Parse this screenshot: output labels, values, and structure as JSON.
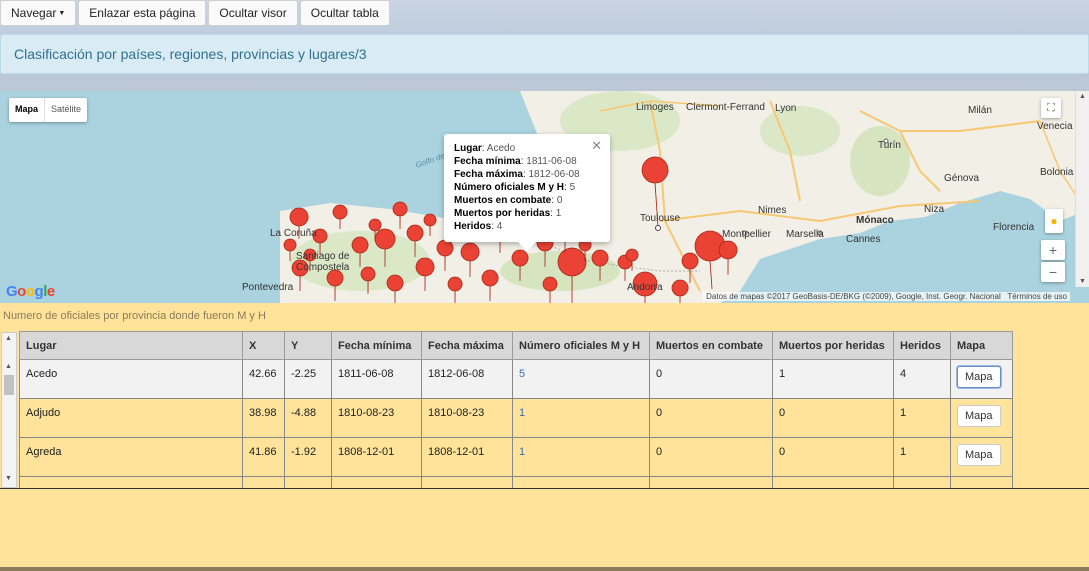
{
  "toolbar": {
    "navegar": "Navegar",
    "enlazar": "Enlazar esta página",
    "ocultar_visor": "Ocultar visor",
    "ocultar_tabla": "Ocultar tabla"
  },
  "banner": {
    "title": "Clasificación por países, regiones, provincias y lugares/3"
  },
  "map": {
    "type_map": "Mapa",
    "type_sat": "Satélite",
    "attribution": "Datos de mapas ©2017 GeoBasis-DE/BKG (©2009), Google, Inst. Geogr. Nacional",
    "terms": "Términos de uso",
    "logo": "Google",
    "labels": {
      "limoges": "Limoges",
      "clermont": "Clermont-Ferrand",
      "lyon": "Lyon",
      "milan": "Milán",
      "venecia": "Venecia",
      "turin": "Turín",
      "genova": "Génova",
      "nimes": "Nimes",
      "montpellier": "Montpellier",
      "marsella": "Marsella",
      "monaco": "Mónaco",
      "toulouse": "Toulouse",
      "cannes": "Cannes",
      "niza": "Niza",
      "florencia": "Florencia",
      "coruna": "La Coruña",
      "santiago": "Santiago de",
      "compostela": "Compostela",
      "pontevedra": "Pontevedra",
      "golfo": "Golfo de",
      "andorra": "Andorra",
      "bolonia": "Bolonia"
    },
    "popup": {
      "lugar_k": "Lugar",
      "lugar_v": "Acedo",
      "fmin_k": "Fecha mínima",
      "fmin_v": "1811-06-08",
      "fmax_k": "Fecha máxima",
      "fmax_v": "1812-06-08",
      "num_k": "Número oficiales M y H",
      "num_v": "5",
      "muertos_k": "Muertos en combate",
      "muertos_v": "0",
      "heridas_k": "Muertos por heridas",
      "heridas_v": "1",
      "heridos_k": "Heridos",
      "heridos_v": "4"
    }
  },
  "caption": "Numero de oficiales por provincia donde fueron M y H",
  "table": {
    "headers": [
      "Lugar",
      "X",
      "Y",
      "Fecha mínima",
      "Fecha máxima",
      "Número oficiales M y H",
      "Muertos en combate",
      "Muertos por heridas",
      "Heridos",
      "Mapa"
    ],
    "rows": [
      {
        "lugar": "Acedo",
        "x": "42.66",
        "y": "-2.25",
        "fmin": "1811-06-08",
        "fmax": "1812-06-08",
        "num": "5",
        "muertos": "0",
        "heridas": "1",
        "heridos": "4",
        "mapa": "Mapa"
      },
      {
        "lugar": "Adjudo",
        "x": "38.98",
        "y": "-4.88",
        "fmin": "1810-08-23",
        "fmax": "1810-08-23",
        "num": "1",
        "muertos": "0",
        "heridas": "0",
        "heridos": "1",
        "mapa": "Mapa"
      },
      {
        "lugar": "Agreda",
        "x": "41.86",
        "y": "-1.92",
        "fmin": "1808-12-01",
        "fmax": "1808-12-01",
        "num": "1",
        "muertos": "0",
        "heridas": "0",
        "heridos": "1",
        "mapa": "Mapa"
      }
    ]
  },
  "colors": {
    "banner_bg": "#d9ecf5",
    "banner_text": "#31708f",
    "lower_bg": "#ffe39b",
    "marker": "#ea4335"
  }
}
